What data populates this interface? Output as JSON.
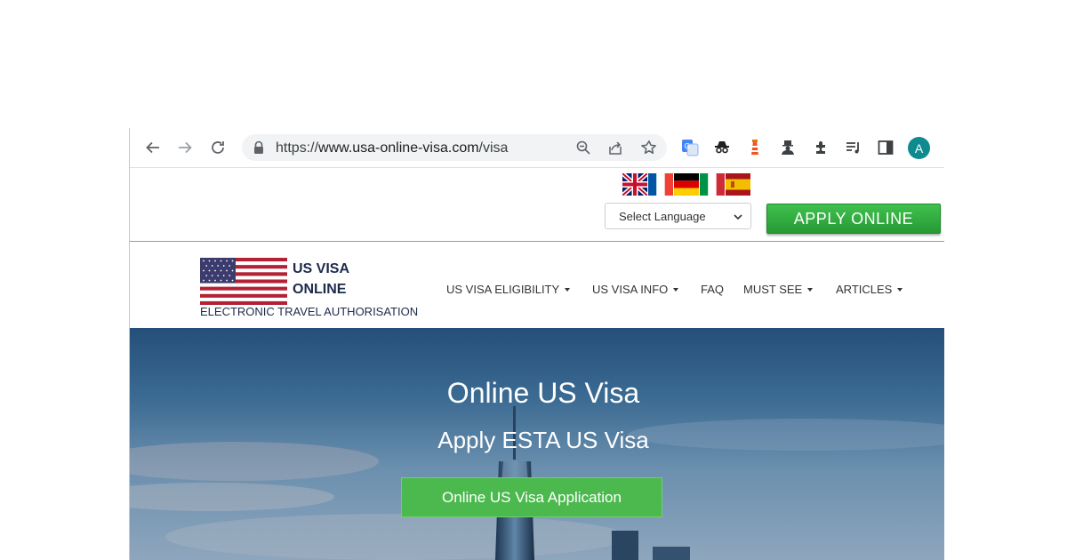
{
  "browser": {
    "url_scheme": "https://",
    "url_host": "www.usa-online-visa.com",
    "url_path": "/visa",
    "profile_initial": "A",
    "icons": [
      "back-icon",
      "forward-icon",
      "reload-icon",
      "lock-icon",
      "zoom-icon",
      "share-icon",
      "star-icon",
      "translate-extension-icon",
      "incognito-extension-icon",
      "lighthouse-extension-icon",
      "spy-extension-icon",
      "extensions-puzzle-icon",
      "media-controls-icon",
      "side-panel-icon"
    ]
  },
  "language_bar": {
    "flags": [
      "uk-flag",
      "france-flag",
      "germany-flag",
      "italy-flag",
      "spain-flag"
    ],
    "select_value": "Select Language",
    "apply_label": "APPLY ONLINE"
  },
  "header": {
    "logo_line1": "US VISA",
    "logo_line2": "ONLINE",
    "tagline": "ELECTRONIC TRAVEL AUTHORISATION",
    "nav": [
      {
        "label": "US VISA ELIGIBILITY",
        "dropdown": true
      },
      {
        "label": "US VISA INFO",
        "dropdown": true
      },
      {
        "label": "FAQ",
        "dropdown": false
      },
      {
        "label": "MUST SEE",
        "dropdown": true
      },
      {
        "label": "ARTICLES",
        "dropdown": true
      }
    ]
  },
  "hero": {
    "title": "Online US Visa",
    "subtitle": "Apply ESTA US Visa",
    "cta": "Online US Visa Application"
  },
  "colors": {
    "apply_green": "#2fb03e",
    "cta_green": "#4cb94f",
    "logo_navy": "#1c2b4a",
    "avatar_teal": "#0f8a8f"
  }
}
